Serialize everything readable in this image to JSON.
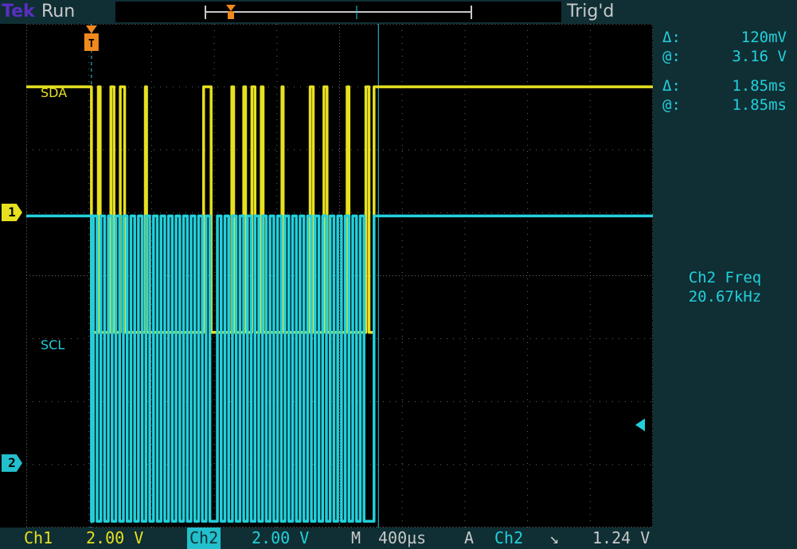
{
  "window": {
    "brand": "Tek",
    "acquisition_state": "Run",
    "trigger_state": "Trig'd"
  },
  "measurements": {
    "cursor1": {
      "delta_symbol": "Δ:",
      "delta_value": "120mV",
      "at_symbol": "@:",
      "at_value": "3.16 V"
    },
    "cursor2": {
      "delta_symbol": "Δ:",
      "delta_value": "1.85ms",
      "at_symbol": "@:",
      "at_value": "1.85ms"
    },
    "frequency": {
      "label": "Ch2 Freq",
      "value": "20.67kHz"
    }
  },
  "channels": {
    "ch1": {
      "marker": "1",
      "trace_label": "SDA",
      "color": "#e6e020"
    },
    "ch2": {
      "marker": "2",
      "trace_label": "SCL",
      "color": "#22d0dc"
    }
  },
  "bottom": {
    "ch1_label": "Ch1",
    "ch1_scale": "2.00 V",
    "ch2_label": "Ch2",
    "ch2_scale": "2.00 V",
    "timebase_label": "M",
    "timebase_value": "400µs",
    "trigger_mode": "A",
    "trigger_source": "Ch2",
    "trigger_slope": "↘",
    "trigger_level": "1.24 V"
  },
  "icons": {
    "trigger_marker": "trigger-position-icon",
    "slope": "falling-edge-icon",
    "level": "trigger-level-arrow-icon"
  },
  "chart_data": {
    "type": "line",
    "x_range": [
      0,
      10
    ],
    "y_range": [
      -4,
      4
    ],
    "grid": true,
    "series": [
      {
        "name": "SDA",
        "high": 3.0,
        "low": -0.9,
        "segments": [
          [
            0,
            1
          ],
          [
            1.04,
            0
          ],
          [
            1.15,
            1
          ],
          [
            1.18,
            0
          ],
          [
            1.35,
            1
          ],
          [
            1.4,
            0
          ],
          [
            1.5,
            1
          ],
          [
            1.57,
            0
          ],
          [
            1.9,
            1
          ],
          [
            1.92,
            0
          ],
          [
            2.83,
            1
          ],
          [
            2.95,
            0
          ],
          [
            3.28,
            1
          ],
          [
            3.31,
            0
          ],
          [
            3.47,
            1
          ],
          [
            3.5,
            0
          ],
          [
            3.6,
            1
          ],
          [
            3.65,
            0
          ],
          [
            3.75,
            1
          ],
          [
            3.78,
            0
          ],
          [
            4.08,
            1
          ],
          [
            4.1,
            0
          ],
          [
            4.53,
            1
          ],
          [
            4.58,
            0
          ],
          [
            4.75,
            1
          ],
          [
            4.8,
            0
          ],
          [
            5.12,
            1
          ],
          [
            5.15,
            0
          ],
          [
            5.42,
            1
          ],
          [
            5.47,
            0
          ],
          [
            5.55,
            1
          ],
          [
            10,
            1
          ]
        ]
      },
      {
        "name": "SCL",
        "high": 0.95,
        "low": -3.9,
        "segments": [
          [
            0,
            1
          ],
          [
            1.04,
            0
          ],
          [
            1.07,
            1
          ],
          [
            1.13,
            0
          ],
          [
            1.19,
            1
          ],
          [
            1.25,
            0
          ],
          [
            1.31,
            1
          ],
          [
            1.37,
            0
          ],
          [
            1.43,
            1
          ],
          [
            1.49,
            0
          ],
          [
            1.55,
            1
          ],
          [
            1.61,
            0
          ],
          [
            1.67,
            1
          ],
          [
            1.73,
            0
          ],
          [
            1.79,
            1
          ],
          [
            1.85,
            0
          ],
          [
            1.91,
            1
          ],
          [
            1.97,
            0
          ],
          [
            2.03,
            1
          ],
          [
            2.09,
            0
          ],
          [
            2.15,
            1
          ],
          [
            2.21,
            0
          ],
          [
            2.27,
            1
          ],
          [
            2.33,
            0
          ],
          [
            2.39,
            1
          ],
          [
            2.45,
            0
          ],
          [
            2.51,
            1
          ],
          [
            2.57,
            0
          ],
          [
            2.63,
            1
          ],
          [
            2.69,
            0
          ],
          [
            2.75,
            1
          ],
          [
            2.81,
            0
          ],
          [
            2.87,
            1
          ],
          [
            2.93,
            0
          ],
          [
            3.05,
            1
          ],
          [
            3.11,
            0
          ],
          [
            3.17,
            1
          ],
          [
            3.23,
            0
          ],
          [
            3.29,
            1
          ],
          [
            3.35,
            0
          ],
          [
            3.41,
            1
          ],
          [
            3.47,
            0
          ],
          [
            3.53,
            1
          ],
          [
            3.59,
            0
          ],
          [
            3.65,
            1
          ],
          [
            3.71,
            0
          ],
          [
            3.77,
            1
          ],
          [
            3.83,
            0
          ],
          [
            3.89,
            1
          ],
          [
            3.95,
            0
          ],
          [
            4.01,
            1
          ],
          [
            4.07,
            0
          ],
          [
            4.13,
            1
          ],
          [
            4.19,
            0
          ],
          [
            4.25,
            1
          ],
          [
            4.31,
            0
          ],
          [
            4.37,
            1
          ],
          [
            4.43,
            0
          ],
          [
            4.49,
            1
          ],
          [
            4.55,
            0
          ],
          [
            4.61,
            1
          ],
          [
            4.67,
            0
          ],
          [
            4.73,
            1
          ],
          [
            4.79,
            0
          ],
          [
            4.85,
            1
          ],
          [
            4.91,
            0
          ],
          [
            4.97,
            1
          ],
          [
            5.03,
            0
          ],
          [
            5.09,
            1
          ],
          [
            5.15,
            0
          ],
          [
            5.21,
            1
          ],
          [
            5.27,
            0
          ],
          [
            5.33,
            1
          ],
          [
            5.39,
            0
          ],
          [
            5.55,
            1
          ],
          [
            10,
            1
          ]
        ]
      }
    ],
    "cursors_x": [
      1.04,
      5.62
    ],
    "trigger_position_x": 1.04
  }
}
